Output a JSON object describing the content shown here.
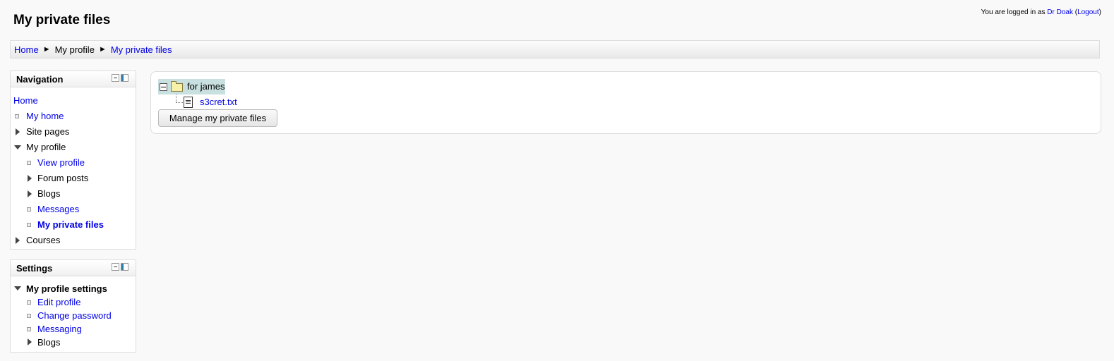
{
  "page": {
    "title": "My private files"
  },
  "login": {
    "prefix": "You are logged in as ",
    "user": "Dr Doak",
    "logout": "Logout"
  },
  "breadcrumb": {
    "items": [
      "Home",
      "My profile",
      "My private files"
    ],
    "separator": "►"
  },
  "navigation": {
    "title": "Navigation",
    "home": "Home",
    "items": [
      {
        "label": "My home"
      },
      {
        "label": "Site pages"
      },
      {
        "label": "My profile"
      },
      {
        "label": "View profile"
      },
      {
        "label": "Forum posts"
      },
      {
        "label": "Blogs"
      },
      {
        "label": "Messages"
      },
      {
        "label": "My private files"
      },
      {
        "label": "Courses"
      }
    ]
  },
  "settings": {
    "title": "Settings",
    "items": [
      {
        "label": "My profile settings"
      },
      {
        "label": "Edit profile"
      },
      {
        "label": "Change password"
      },
      {
        "label": "Messaging"
      },
      {
        "label": "Blogs"
      }
    ]
  },
  "files": {
    "folder": "for james",
    "file": "s3cret.txt",
    "manage_button": "Manage my private files"
  },
  "colors": {
    "link": "#0000e6",
    "selected_folder_bg": "#c8e0e0"
  }
}
